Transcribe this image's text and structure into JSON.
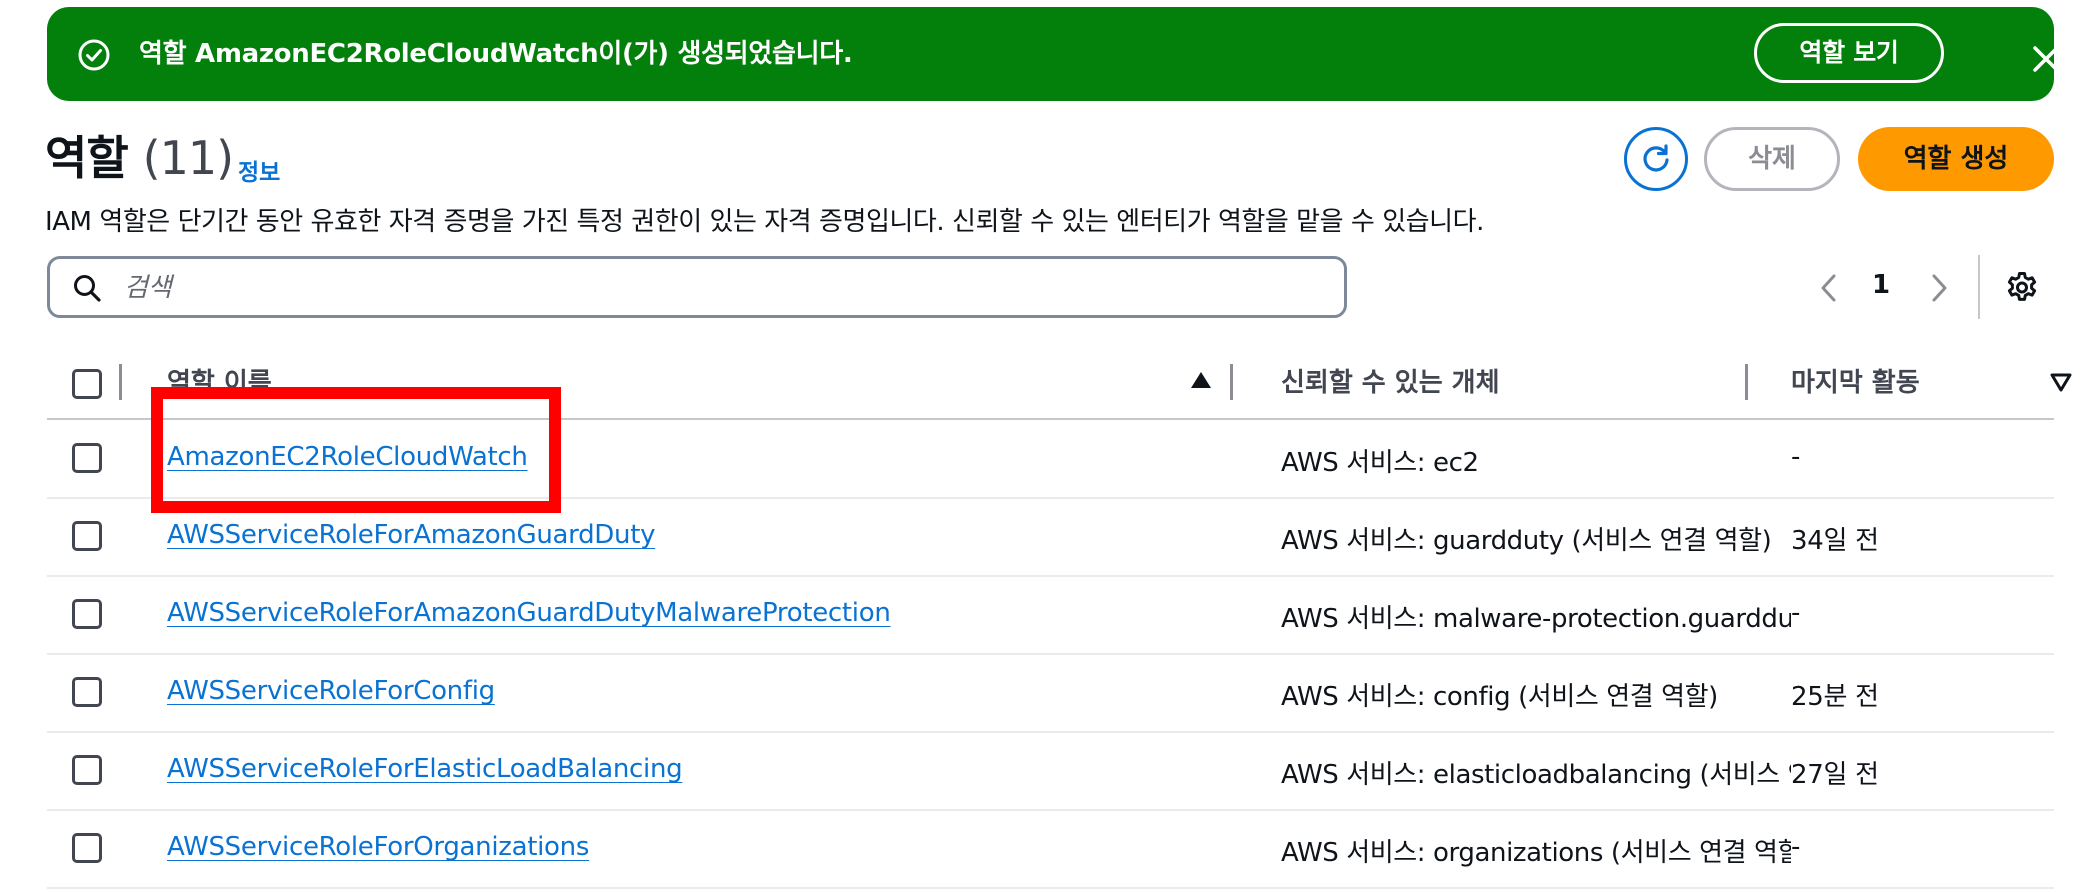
{
  "flash": {
    "message": "역할 AmazonEC2RoleCloudWatch이(가) 생성되었습니다.",
    "view_button": "역할 보기",
    "icons": {
      "status": "check-circle-icon",
      "close": "close-icon"
    }
  },
  "header": {
    "title": "역할",
    "count": "(11)",
    "info_link": "정보",
    "description": "IAM 역할은 단기간 동안 유효한 자격 증명을 가진 특정 권한이 있는 자격 증명입니다. 신뢰할 수 있는 엔터티가 역할을 맡을 수 있습니다.",
    "delete_button": "삭제",
    "create_button": "역할 생성"
  },
  "search": {
    "placeholder": "검색",
    "value": ""
  },
  "pagination": {
    "current_page": "1"
  },
  "table": {
    "columns": [
      "역할 이름",
      "신뢰할 수 있는 개체",
      "마지막 활동"
    ],
    "rows": [
      {
        "name": "AmazonEC2RoleCloudWatch",
        "trusted": "AWS 서비스: ec2",
        "trusted_note": "",
        "last_activity": "-"
      },
      {
        "name": "AWSServiceRoleForAmazonGuardDuty",
        "trusted": "AWS 서비스: guardduty ",
        "trusted_note": "(서비스 연결 역할)",
        "last_activity": "34일 전"
      },
      {
        "name": "AWSServiceRoleForAmazonGuardDutyMalwareProtection",
        "trusted": "AWS 서비스: malware-protection.guardduty",
        "trusted_note": "",
        "last_activity": "-"
      },
      {
        "name": "AWSServiceRoleForConfig",
        "trusted": "AWS 서비스: config ",
        "trusted_note": "(서비스 연결 역할)",
        "last_activity": "25분 전"
      },
      {
        "name": "AWSServiceRoleForElasticLoadBalancing",
        "trusted": "AWS 서비스: elasticloadbalancing ",
        "trusted_note": "(서비스 연결 역할)",
        "last_activity": "27일 전"
      },
      {
        "name": "AWSServiceRoleForOrganizations",
        "trusted": "AWS 서비스: organizations ",
        "trusted_note": "(서비스 연결 역할)",
        "last_activity": "-"
      }
    ]
  },
  "colors": {
    "success_green": "#037f0c",
    "link_blue": "#0972d3",
    "primary_orange": "#ff9900",
    "highlight_red": "#ff0000"
  }
}
